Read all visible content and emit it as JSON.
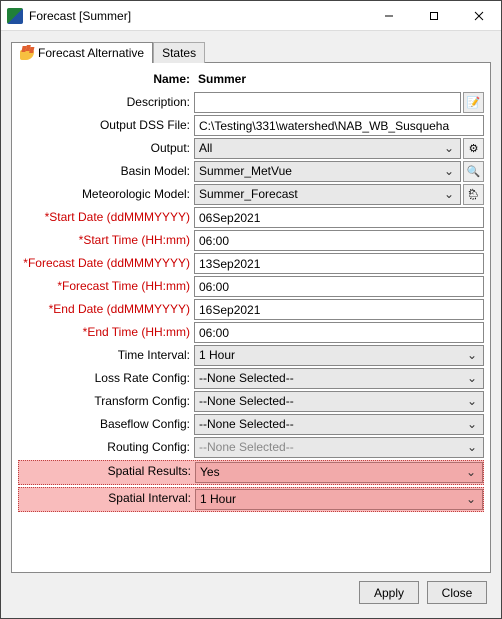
{
  "window": {
    "title": "Forecast [Summer]"
  },
  "tabs": {
    "active": "Forecast Alternative",
    "items": [
      {
        "label": "Forecast Alternative"
      },
      {
        "label": "States"
      }
    ]
  },
  "form": {
    "name_label": "Name:",
    "name_value": "Summer",
    "description_label": "Description:",
    "description_value": "",
    "output_dss_label": "Output DSS File:",
    "output_dss_value": "C:\\Testing\\331\\watershed\\NAB_WB_Susqueha",
    "output_label": "Output:",
    "output_value": "All",
    "basin_label": "Basin Model:",
    "basin_value": "Summer_MetVue",
    "met_label": "Meteorologic Model:",
    "met_value": "Summer_Forecast",
    "start_date_label": "Start Date (ddMMMYYYY)",
    "start_date_value": "06Sep2021",
    "start_time_label": "Start Time (HH:mm)",
    "start_time_value": "06:00",
    "forecast_date_label": "Forecast Date (ddMMMYYYY)",
    "forecast_date_value": "13Sep2021",
    "forecast_time_label": "Forecast Time (HH:mm)",
    "forecast_time_value": "06:00",
    "end_date_label": "End Date (ddMMMYYYY)",
    "end_date_value": "16Sep2021",
    "end_time_label": "End Time (HH:mm)",
    "end_time_value": "06:00",
    "time_interval_label": "Time Interval:",
    "time_interval_value": "1 Hour",
    "loss_label": "Loss Rate Config:",
    "loss_value": "--None Selected--",
    "transform_label": "Transform Config:",
    "transform_value": "--None Selected--",
    "baseflow_label": "Baseflow Config:",
    "baseflow_value": "--None Selected--",
    "routing_label": "Routing Config:",
    "routing_value": "--None Selected--",
    "spatial_results_label": "Spatial Results:",
    "spatial_results_value": "Yes",
    "spatial_interval_label": "Spatial Interval:",
    "spatial_interval_value": "1 Hour"
  },
  "footer": {
    "apply": "Apply",
    "close": "Close"
  },
  "icons": {
    "desc_edit": "📝",
    "gear": "⚙",
    "basin": "🔍",
    "met": "🌦"
  }
}
